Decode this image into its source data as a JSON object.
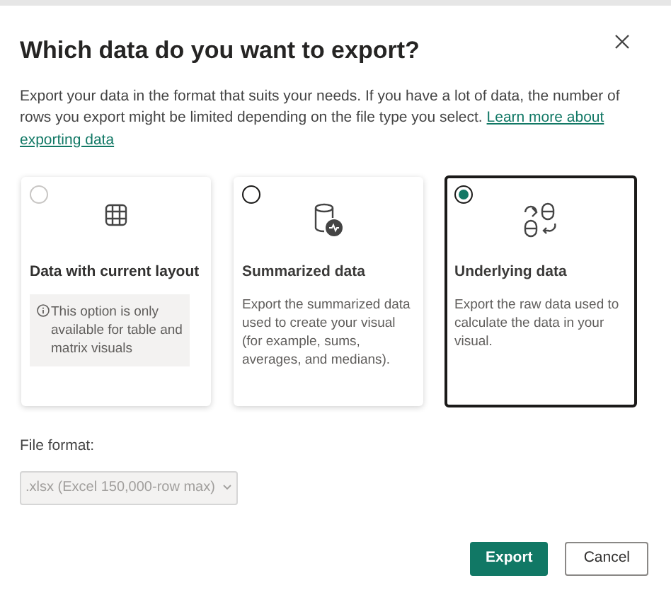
{
  "dialog": {
    "title": "Which data do you want to export?",
    "description": "Export your data in the format that suits your needs. If you have a lot of data, the number of rows you export might be limited depending on the file type you select.",
    "link_lines": [
      "Learn more about",
      "exporting data"
    ]
  },
  "options": [
    {
      "title": "Data with current layout",
      "note": "This option is only available for table and matrix visuals",
      "selected": false,
      "disabled": true
    },
    {
      "title": "Summarized data",
      "description": "Export the summarized data used to create your visual (for example, sums, averages, and medians).",
      "selected": false,
      "disabled": false
    },
    {
      "title": "Underlying data",
      "description": "Export the raw data used to calculate the data in your visual.",
      "selected": true,
      "disabled": false
    }
  ],
  "file_format": {
    "label": "File format:",
    "value": ".xlsx (Excel 150,000-row max)",
    "disabled": true
  },
  "buttons": [
    {
      "label": "Export",
      "kind": "primary"
    },
    {
      "label": "Cancel",
      "kind": "secondary"
    }
  ]
}
